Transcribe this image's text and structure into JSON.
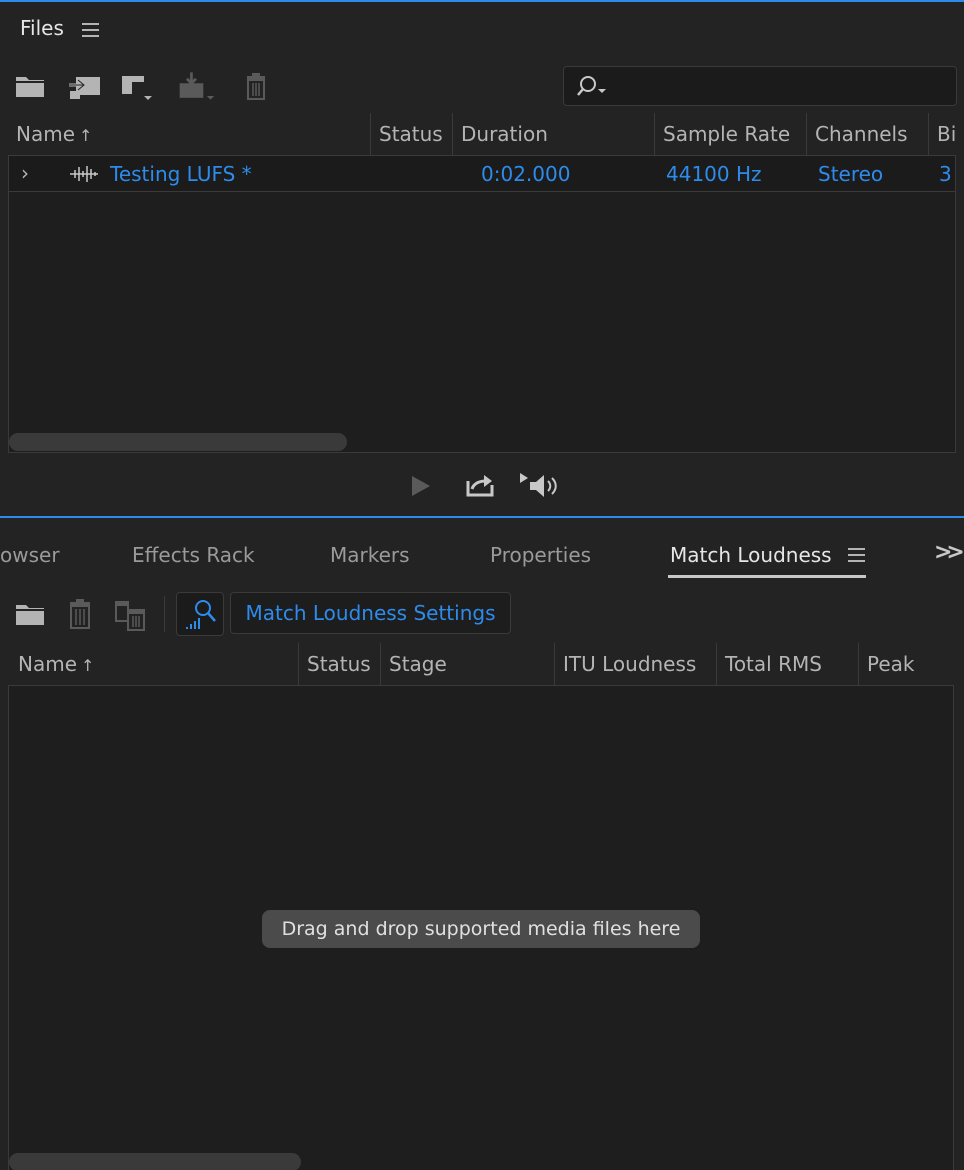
{
  "files_panel": {
    "title": "Files",
    "search": {
      "placeholder": "",
      "value": ""
    },
    "columns": [
      "Name",
      "Status",
      "Duration",
      "Sample Rate",
      "Channels",
      "Bi"
    ],
    "sort_indicator": "↑",
    "rows": [
      {
        "name": "Testing LUFS *",
        "status": "",
        "duration": "0:02.000",
        "sample_rate": "44100 Hz",
        "channels": "Stereo",
        "bits": "3"
      }
    ],
    "toolbar_icons": [
      "open-file-icon",
      "import-icon",
      "insert-into-multitrack-icon",
      "batch-import-icon",
      "delete-icon"
    ],
    "transport_icons": [
      "play-icon",
      "loop-icon",
      "autoplay-volume-icon"
    ]
  },
  "loudness_panel": {
    "tabs": [
      {
        "label": "owser",
        "active": false
      },
      {
        "label": "Effects Rack",
        "active": false
      },
      {
        "label": "Markers",
        "active": false
      },
      {
        "label": "Properties",
        "active": false
      },
      {
        "label": "Match Loudness",
        "active": true
      }
    ],
    "overflow_label": ">>",
    "settings_button": "Match Loudness Settings",
    "columns": [
      "Name",
      "Status",
      "Stage",
      "ITU Loudness",
      "Total RMS",
      "Peak"
    ],
    "sort_indicator": "↑",
    "drop_hint": "Drag and drop supported media files here"
  },
  "colors": {
    "accent": "#2d8ceb",
    "panel_bg": "#232323",
    "list_bg": "#1e1e1e",
    "text": "#b4b4b4"
  }
}
